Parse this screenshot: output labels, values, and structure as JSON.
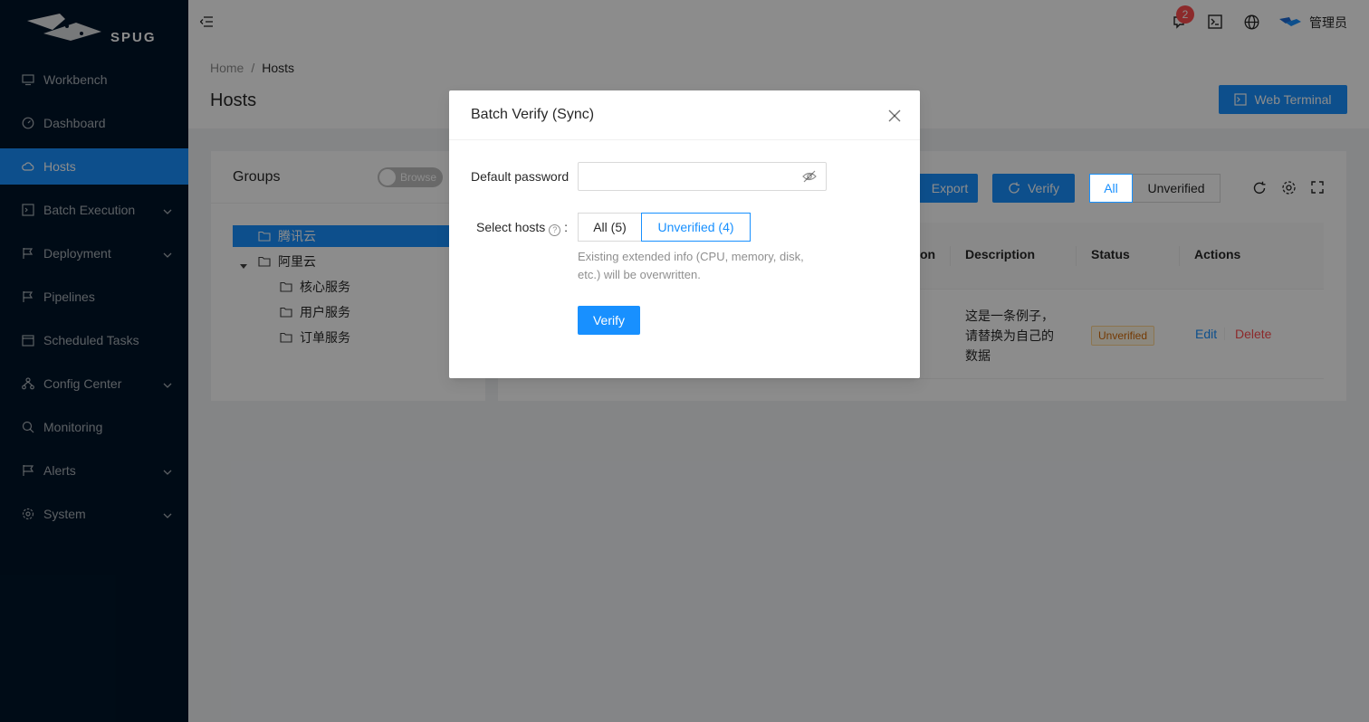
{
  "sidebar": {
    "logo_text": "SPUG",
    "items": [
      {
        "label": "Workbench",
        "icon": "desktop-icon"
      },
      {
        "label": "Dashboard",
        "icon": "dashboard-icon"
      },
      {
        "label": "Hosts",
        "icon": "cloud-icon",
        "active": true
      },
      {
        "label": "Batch Execution",
        "icon": "code-icon",
        "submenu": true
      },
      {
        "label": "Deployment",
        "icon": "flag-icon",
        "submenu": true
      },
      {
        "label": "Pipelines",
        "icon": "flag-icon"
      },
      {
        "label": "Scheduled Tasks",
        "icon": "schedule-icon"
      },
      {
        "label": "Config Center",
        "icon": "deployment-unit-icon",
        "submenu": true
      },
      {
        "label": "Monitoring",
        "icon": "monitor-icon"
      },
      {
        "label": "Alerts",
        "icon": "alert-icon",
        "submenu": true
      },
      {
        "label": "System",
        "icon": "setting-icon",
        "submenu": true
      }
    ]
  },
  "header": {
    "notification_count": "2",
    "user_name": "管理员"
  },
  "page": {
    "breadcrumb": [
      "Home",
      "Hosts"
    ],
    "title": "Hosts",
    "web_terminal_label": "Web Terminal"
  },
  "groups": {
    "title": "Groups",
    "toggle_label": "Browse",
    "tree": [
      {
        "label": "腾讯云",
        "selected": true
      },
      {
        "label": "阿里云",
        "expanded": true
      },
      {
        "label": "核心服务"
      },
      {
        "label": "用户服务"
      },
      {
        "label": "订单服务"
      }
    ]
  },
  "hosts_table": {
    "export_label": "Export",
    "verify_label": "Verify",
    "filter_all": "All",
    "filter_unverified": "Unverified",
    "columns": [
      "on",
      "Description",
      "Status",
      "Actions"
    ],
    "rows": [
      {
        "description": "这是一条例子，请替换为自己的数据",
        "description_lines": [
          "这是一条例子，",
          "请替换为自己的",
          "数据"
        ],
        "status": "Unverified",
        "edit": "Edit",
        "delete": "Delete"
      }
    ]
  },
  "modal": {
    "title": "Batch Verify (Sync)",
    "password_label": "Default password",
    "password_value": "",
    "select_hosts_label": "Select hosts",
    "option_all": "All (5)",
    "option_unverified": "Unverified (4)",
    "selected_option": "Unverified (4)",
    "hint": "Existing extended info (CPU, memory, disk, etc.) will be overwritten.",
    "submit_label": "Verify"
  },
  "colors": {
    "primary": "#1890ff",
    "sidebar_bg": "#001529",
    "danger": "#ff4d4f"
  }
}
